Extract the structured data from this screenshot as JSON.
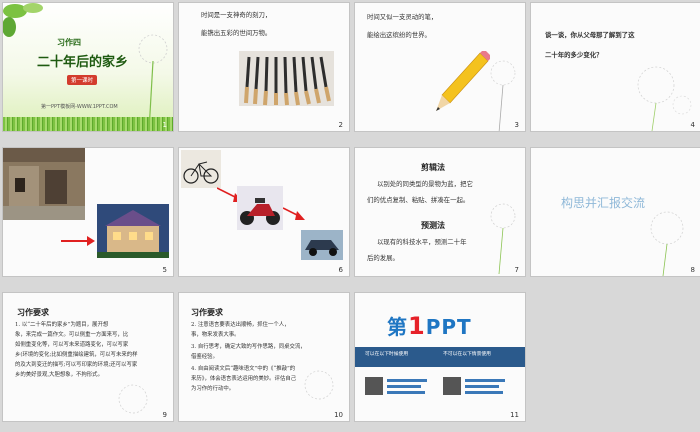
{
  "slides": [
    {
      "num": "1",
      "title_small": "习作四",
      "title_main": "二十年后的家乡",
      "badge": "第一课时",
      "footer": "第一PPT模板网-WWW.1PPT.COM"
    },
    {
      "num": "2",
      "line1": "时间是一支神奇的刻刀，",
      "line2": "能镌出五彩的世间万物。"
    },
    {
      "num": "3",
      "line1": "时间又似一支灵动的笔，",
      "line2": "能绘出这缤纷的世界。"
    },
    {
      "num": "4",
      "line1": "谈一谈，你从父母那了解到了这",
      "line2": "二十年的多少变化？"
    },
    {
      "num": "5"
    },
    {
      "num": "6"
    },
    {
      "num": "7",
      "h1": "剪辑法",
      "p1a": "以别处的同类型的景物为蓝，把它",
      "p1b": "们的优点复制、粘贴、拼凑在一起。",
      "h2": "预测法",
      "p2a": "以现有的科技水平，预测二十年",
      "p2b": "后的发展。"
    },
    {
      "num": "8",
      "text": "构思并汇报交流"
    },
    {
      "num": "9",
      "h": "习作要求",
      "lines": [
        "1. 以“二十年后的家乡”为题目，展开想",
        "象，来完成一篇作文。可以侧重一方面来写，比",
        "如侧重变化等，可以写未来道路变化，可以写家",
        "乡(环境的变化;比如侧重描绘建筑，可以写未来的样",
        "的及大到变迁的描写;可以写印家的环境;还可以写家",
        "乡的美好景观,大胆想象，不拘形式。"
      ]
    },
    {
      "num": "10",
      "h": "习作要求",
      "lines": [
        "2. 注意语言要表达出顺畅，抓住一个人，",
        "事，物来发表大事。",
        "3. 自行思考，确定大致的写作思路，同桌交流，",
        "借鉴经验。",
        "4. 自由阅读文后“趣味语文”中的《“推敲”的",
        "来历》，体会语言表达运用的美妙。评估自己",
        "为习作的行动中。"
      ]
    },
    {
      "num": "11",
      "logo_a": "第",
      "logo_b": "1",
      "logo_c": "PPT",
      "bar_left": "可以在以下时候使用",
      "bar_right": "不可以在以下情景使用"
    }
  ],
  "colors": {
    "title_bg": "#eef7d4",
    "logo_blue": "#1f76c3",
    "logo_red": "#e62129",
    "bar": "#2b5a8c",
    "arrow": "#e02020",
    "soft_blue": "#8fb8d8"
  }
}
